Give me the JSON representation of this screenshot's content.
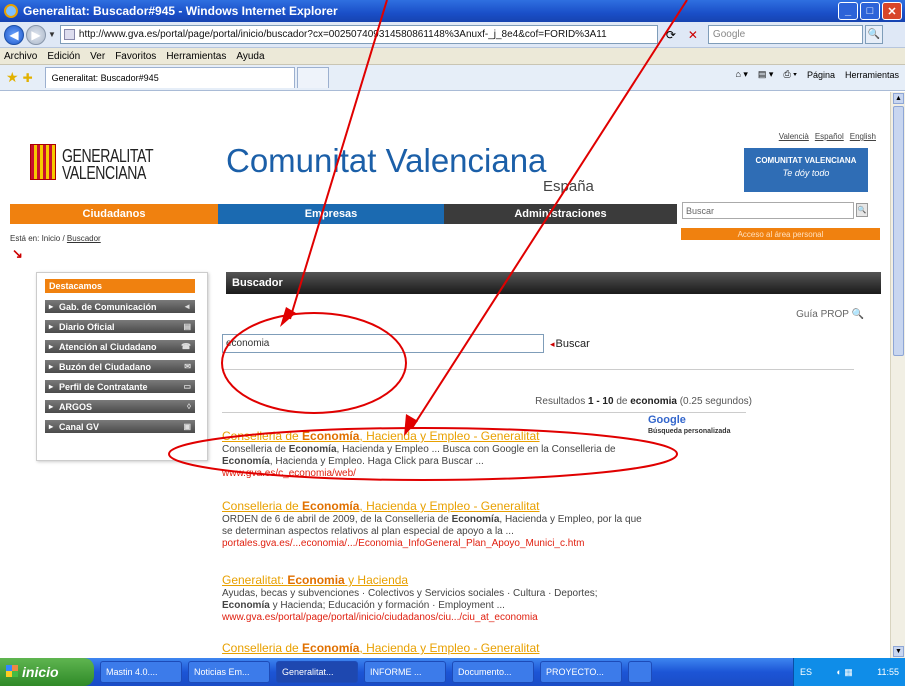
{
  "window": {
    "title": "Generalitat: Buscador#945 - Windows Internet Explorer"
  },
  "browser": {
    "url": "http://www.gva.es/portal/page/portal/inicio/buscador?cx=002507409314580861148%3Anuxf-_j_8e4&cof=FORID%3A11",
    "search_placeholder": "Google",
    "menu": [
      "Archivo",
      "Edición",
      "Ver",
      "Favoritos",
      "Herramientas",
      "Ayuda"
    ],
    "tab_title": "Generalitat: Buscador#945",
    "commands": [
      "Página",
      "Herramientas"
    ]
  },
  "site": {
    "lang_links": [
      "Valencià",
      "Español",
      "English"
    ],
    "logo_line1": "GENERALITAT",
    "logo_line2": "VALENCIANA",
    "title": "Comunitat Valenciana",
    "subtitle": "España",
    "badge_title": "COMUNITAT VALENCIANA",
    "badge_slogan": "Te dóy todo",
    "nav": [
      "Ciudadanos",
      "Empresas",
      "Administraciones"
    ],
    "site_search_placeholder": "Buscar",
    "breadcrumb_prefix": "Está en: Inicio / ",
    "breadcrumb_current": "Buscador",
    "access_button": "Acceso al área personal"
  },
  "sidebar": {
    "title": "Destacamos",
    "items": [
      "Gab. de Comunicación",
      "Diario Oficial",
      "Atención al Ciudadano",
      "Buzón del Ciudadano",
      "Perfil de Contratante",
      "ARGOS",
      "Canal GV"
    ]
  },
  "search": {
    "header": "Buscador",
    "guide_link": "Guía PROP",
    "query": "economia",
    "button": "Buscar",
    "stats_prefix": "Resultados ",
    "stats_range": "1 - 10",
    "stats_mid": " de ",
    "stats_term": "economia",
    "stats_time": " (0.25 segundos)",
    "google_label": "Google",
    "google_sub": "Búsqueda personalizada"
  },
  "results": [
    {
      "title": "Conselleria de Economía, Hacienda y Empleo - Generalitat",
      "snippet": "Conselleria de Economía, Hacienda y Empleo ... Busca con Google en la Conselleria de Economía, Hacienda y Empleo. Haga Click para Buscar ...",
      "url": "www.gva.es/c_economia/web/"
    },
    {
      "title": "Conselleria de Economía, Hacienda y Empleo - Generalitat",
      "snippet": "ORDEN de 6 de abril de 2009, de la Conselleria de Economía, Hacienda y Empleo, por la que se determinan aspectos relativos al plan especial de apoyo a la ...",
      "url": "portales.gva.es/...economia/.../Economia_InfoGeneral_Plan_Apoyo_Munici_c.htm"
    },
    {
      "title": "Generalitat: Economia y Hacienda",
      "snippet": "Ayudas, becas y subvenciones · Colectivos y Servicios sociales · Cultura · Deportes; Economía y Hacienda; Educación y formación · Employment ...",
      "url": "www.gva.es/portal/page/portal/inicio/ciudadanos/ciu.../ciu_at_economia"
    },
    {
      "title": "Conselleria de Economía, Hacienda y Empleo - Generalitat",
      "snippet": "",
      "url": ""
    }
  ],
  "taskbar": {
    "start": "inicio",
    "tasks": [
      "Mastin 4.0....",
      "Noticias Em...",
      "Generalitat...",
      "INFORME ...",
      "Documento...",
      "PROYECTO...",
      ""
    ],
    "tray_lang": "ES",
    "clock": "11:55"
  },
  "colors": {
    "orange": "#f0810f",
    "blue": "#1b6ab1",
    "annotation_red": "#e00000"
  }
}
